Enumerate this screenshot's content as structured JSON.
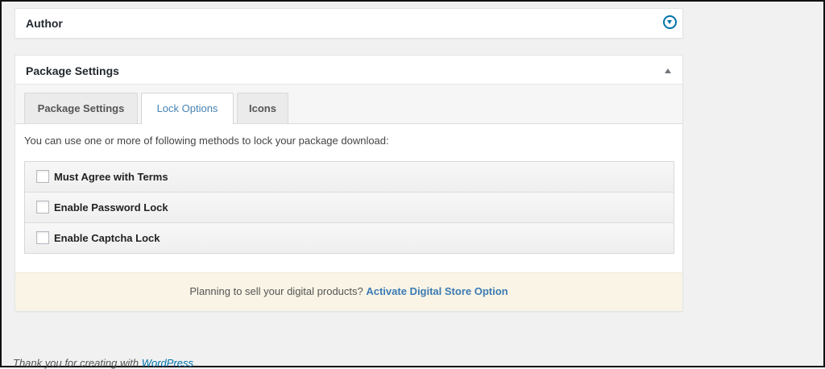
{
  "author_box": {
    "title": "Author",
    "toggle_icon": "chevron-down-circle-icon"
  },
  "package_box": {
    "title": "Package Settings",
    "toggle_icon": "arrow-up-icon",
    "tabs": [
      {
        "label": "Package Settings",
        "active": false
      },
      {
        "label": "Lock Options",
        "active": true
      },
      {
        "label": "Icons",
        "active": false
      }
    ],
    "intro_text": "You can use one or more of following methods to lock your package download:",
    "lock_options": [
      {
        "label": "Must Agree with Terms",
        "checked": false
      },
      {
        "label": "Enable Password Lock",
        "checked": false
      },
      {
        "label": "Enable Captcha Lock",
        "checked": false
      }
    ],
    "promo": {
      "text": "Planning to sell your digital products? ",
      "link_label": "Activate Digital Store Option"
    }
  },
  "footer": {
    "text": "Thank you for creating with ",
    "link_label": "WordPress",
    "suffix": "."
  },
  "colors": {
    "accent": "#0073aa",
    "active_tab_text": "#4783b3",
    "promo_background": "#f9f4e5",
    "page_background": "#f1f1f1"
  }
}
